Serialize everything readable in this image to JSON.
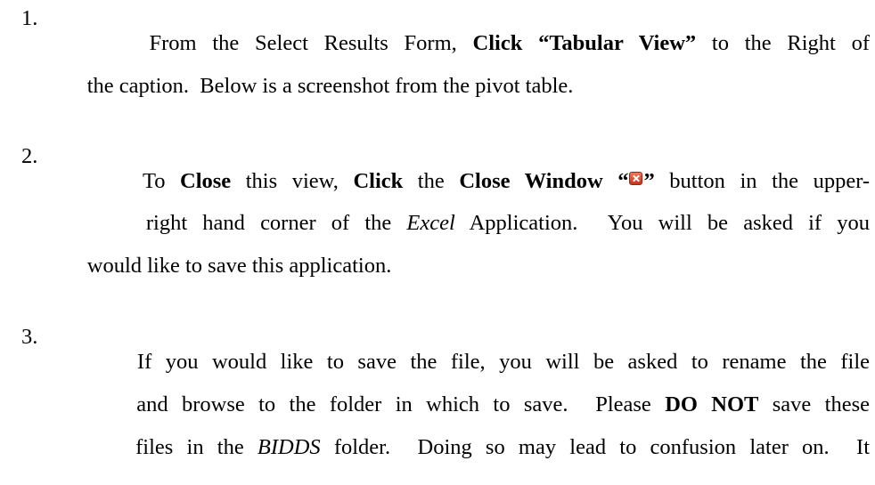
{
  "items": [
    {
      "number": "1.",
      "lines": [
        {
          "parts": [
            {
              "text": "From the Select Results Form, "
            },
            {
              "text": "Click “Tabular View”",
              "bold": true
            },
            {
              "text": " to the Right of"
            }
          ]
        },
        {
          "parts": [
            {
              "text": "the caption.  Below is a screenshot from the pivot table."
            }
          ]
        }
      ]
    },
    {
      "number": "2.",
      "lines": [
        {
          "parts": [
            {
              "text": "To "
            },
            {
              "text": "Close",
              "bold": true
            },
            {
              "text": " this view, "
            },
            {
              "text": "Click",
              "bold": true
            },
            {
              "text": " the "
            },
            {
              "text": "Close Window “",
              "bold": true
            },
            {
              "icon": "close-icon"
            },
            {
              "text": "”",
              "bold": true
            },
            {
              "text": " button in the upper-"
            }
          ]
        },
        {
          "parts": [
            {
              "text": "right hand corner of the "
            },
            {
              "text": "Excel",
              "italic": true
            },
            {
              "text": " Application.  You will be asked if you"
            }
          ]
        },
        {
          "parts": [
            {
              "text": "would like to save this application."
            }
          ]
        }
      ]
    },
    {
      "number": "3.",
      "lines": [
        {
          "parts": [
            {
              "text": "If you would like to save the file, you will be asked to rename the file"
            }
          ]
        },
        {
          "parts": [
            {
              "text": "and browse to the folder in which to save.  Please "
            },
            {
              "text": "DO NOT",
              "bold": true
            },
            {
              "text": " save these"
            }
          ]
        },
        {
          "parts": [
            {
              "text": "files in the "
            },
            {
              "text": "BIDDS",
              "italic": true
            },
            {
              "text": " folder.  Doing so may lead to confusion later on.  It"
            }
          ]
        }
      ]
    }
  ]
}
